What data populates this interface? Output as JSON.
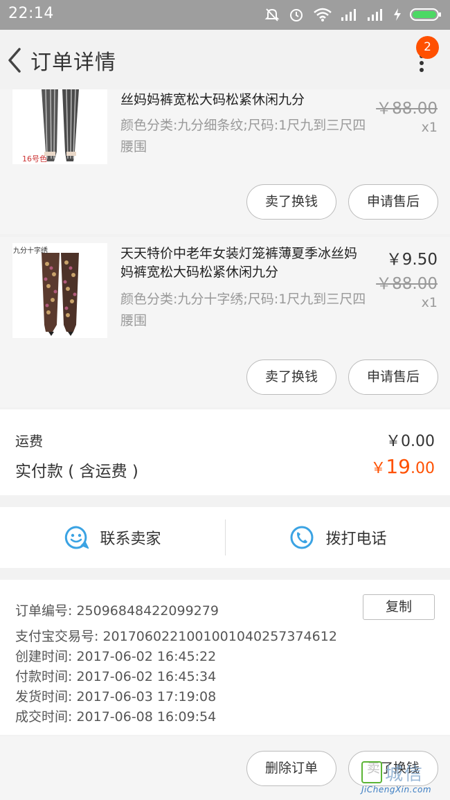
{
  "status_bar": {
    "time": "22:14"
  },
  "header": {
    "title": "订单详情",
    "badge": "2"
  },
  "items": [
    {
      "name": "丝妈妈裤宽松大码松紧休闲九分",
      "sku": "颜色分类:九分细条纹;尺码:1尺九到三尺四腰围",
      "original_price": "￥88.00",
      "quantity": "x1",
      "image_label": "16号色",
      "buttons": [
        "卖了换钱",
        "申请售后"
      ]
    },
    {
      "name": "天天特价中老年女装灯笼裤薄夏季冰丝妈妈裤宽松大码松紧休闲九分",
      "sku": "颜色分类:九分十字绣;尺码:1尺九到三尺四腰围",
      "price": "￥9.50",
      "original_price": "￥88.00",
      "quantity": "x1",
      "image_label": "九分十字绣",
      "buttons": [
        "卖了换钱",
        "申请售后"
      ]
    }
  ],
  "summary": {
    "shipping_label": "运费",
    "shipping_value": "￥0.00",
    "paid_label": "实付款 ( 含运费 )",
    "paid_symbol": "￥",
    "paid_int": "19",
    "paid_dec": ".00"
  },
  "contact": {
    "seller": "联系卖家",
    "phone": "拨打电话"
  },
  "order_info": {
    "copy": "复制",
    "lines": [
      "订单编号:   25096848422099279",
      "支付宝交易号:   2017060221001001040257374612",
      "创建时间:   2017-06-02 16:45:22",
      "付款时间:   2017-06-02 16:45:34",
      "发货时间:   2017-06-03 17:19:08",
      "成交时间:   2017-06-08 16:09:54"
    ]
  },
  "footer": {
    "delete": "删除订单",
    "sell": "卖了换钱"
  },
  "watermark": {
    "text": "城信",
    "url": "JiChengXin.com"
  },
  "colors": {
    "accent": "#ff5000",
    "icon_blue": "#3ba3e3",
    "status_bar": "#9e9e9e"
  }
}
